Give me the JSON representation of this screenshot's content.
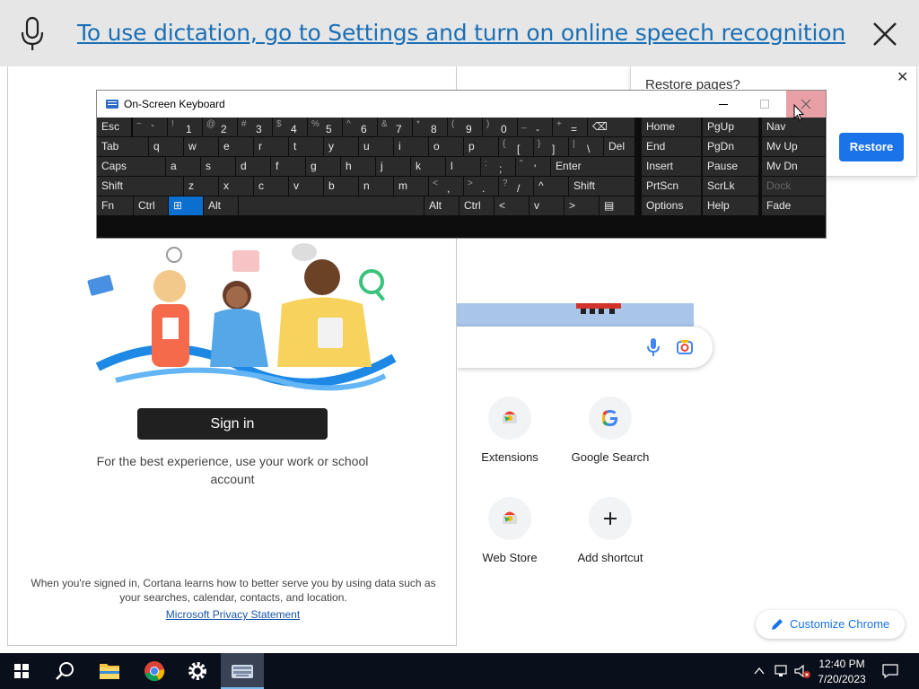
{
  "dictation": {
    "message": "To use dictation, go to Settings and turn on online speech recognition"
  },
  "osk": {
    "title": "On-Screen Keyboard",
    "rows": [
      [
        {
          "sh": "",
          "mn": "Esc"
        },
        {
          "sh": "~",
          "mn": "`"
        },
        {
          "sh": "!",
          "mn": "1"
        },
        {
          "sh": "@",
          "mn": "2"
        },
        {
          "sh": "#",
          "mn": "3"
        },
        {
          "sh": "$",
          "mn": "4"
        },
        {
          "sh": "%",
          "mn": "5"
        },
        {
          "sh": "^",
          "mn": "6"
        },
        {
          "sh": "&",
          "mn": "7"
        },
        {
          "sh": "*",
          "mn": "8"
        },
        {
          "sh": "(",
          "mn": "9"
        },
        {
          "sh": ")",
          "mn": "0"
        },
        {
          "sh": "_",
          "mn": "-"
        },
        {
          "sh": "+",
          "mn": "="
        },
        {
          "sh": "",
          "mn": "⌫"
        }
      ],
      [
        {
          "sh": "",
          "mn": "Tab"
        },
        {
          "sh": "",
          "mn": "q"
        },
        {
          "sh": "",
          "mn": "w"
        },
        {
          "sh": "",
          "mn": "e"
        },
        {
          "sh": "",
          "mn": "r"
        },
        {
          "sh": "",
          "mn": "t"
        },
        {
          "sh": "",
          "mn": "y"
        },
        {
          "sh": "",
          "mn": "u"
        },
        {
          "sh": "",
          "mn": "i"
        },
        {
          "sh": "",
          "mn": "o"
        },
        {
          "sh": "",
          "mn": "p"
        },
        {
          "sh": "{",
          "mn": "["
        },
        {
          "sh": "}",
          "mn": "]"
        },
        {
          "sh": "|",
          "mn": "\\"
        },
        {
          "sh": "",
          "mn": "Del"
        }
      ],
      [
        {
          "sh": "",
          "mn": "Caps"
        },
        {
          "sh": "",
          "mn": "a"
        },
        {
          "sh": "",
          "mn": "s"
        },
        {
          "sh": "",
          "mn": "d"
        },
        {
          "sh": "",
          "mn": "f"
        },
        {
          "sh": "",
          "mn": "g"
        },
        {
          "sh": "",
          "mn": "h"
        },
        {
          "sh": "",
          "mn": "j"
        },
        {
          "sh": "",
          "mn": "k"
        },
        {
          "sh": "",
          "mn": "l"
        },
        {
          "sh": ":",
          "mn": ";"
        },
        {
          "sh": "\"",
          "mn": "'"
        },
        {
          "sh": "",
          "mn": "Enter"
        }
      ],
      [
        {
          "sh": "",
          "mn": "Shift"
        },
        {
          "sh": "",
          "mn": "z"
        },
        {
          "sh": "",
          "mn": "x"
        },
        {
          "sh": "",
          "mn": "c"
        },
        {
          "sh": "",
          "mn": "v"
        },
        {
          "sh": "",
          "mn": "b"
        },
        {
          "sh": "",
          "mn": "n"
        },
        {
          "sh": "",
          "mn": "m"
        },
        {
          "sh": "<",
          "mn": ","
        },
        {
          "sh": ">",
          "mn": "."
        },
        {
          "sh": "?",
          "mn": "/"
        },
        {
          "sh": "",
          "mn": "^"
        },
        {
          "sh": "",
          "mn": "Shift"
        }
      ],
      [
        {
          "sh": "",
          "mn": "Fn"
        },
        {
          "sh": "",
          "mn": "Ctrl"
        },
        {
          "sh": "",
          "mn": "⊞"
        },
        {
          "sh": "",
          "mn": "Alt"
        },
        {
          "sh": "",
          "mn": ""
        },
        {
          "sh": "",
          "mn": "Alt"
        },
        {
          "sh": "",
          "mn": "Ctrl"
        },
        {
          "sh": "",
          "mn": "<"
        },
        {
          "sh": "",
          "mn": "v"
        },
        {
          "sh": "",
          "mn": ">"
        },
        {
          "sh": "",
          "mn": "▤"
        }
      ]
    ],
    "nav_keys": [
      [
        "Home",
        "PgUp",
        "Nav"
      ],
      [
        "End",
        "PgDn",
        "Mv Up"
      ],
      [
        "Insert",
        "Pause",
        "Mv Dn"
      ],
      [
        "PrtScn",
        "ScrLk",
        "Dock"
      ],
      [
        "Options",
        "Help",
        "Fade"
      ]
    ]
  },
  "restore": {
    "title": "Restore pages?",
    "button": "Restore"
  },
  "cortana": {
    "signin": "Sign in",
    "desc": "For the best experience, use your work or school account",
    "note": "When you're signed in, Cortana learns how to better serve you by using data such as your searches, calendar, contacts, and location.",
    "privacy": "Microsoft Privacy Statement"
  },
  "shortcuts": [
    {
      "label": "Extensions",
      "icon": "chrome-web-store-icon"
    },
    {
      "label": "Google Search",
      "icon": "google-icon"
    },
    {
      "label": "Web Store",
      "icon": "chrome-web-store-icon"
    },
    {
      "label": "Add shortcut",
      "icon": "plus-icon"
    }
  ],
  "customize": "Customize Chrome",
  "taskbar": {
    "time": "12:40 PM",
    "date": "7/20/2023"
  }
}
